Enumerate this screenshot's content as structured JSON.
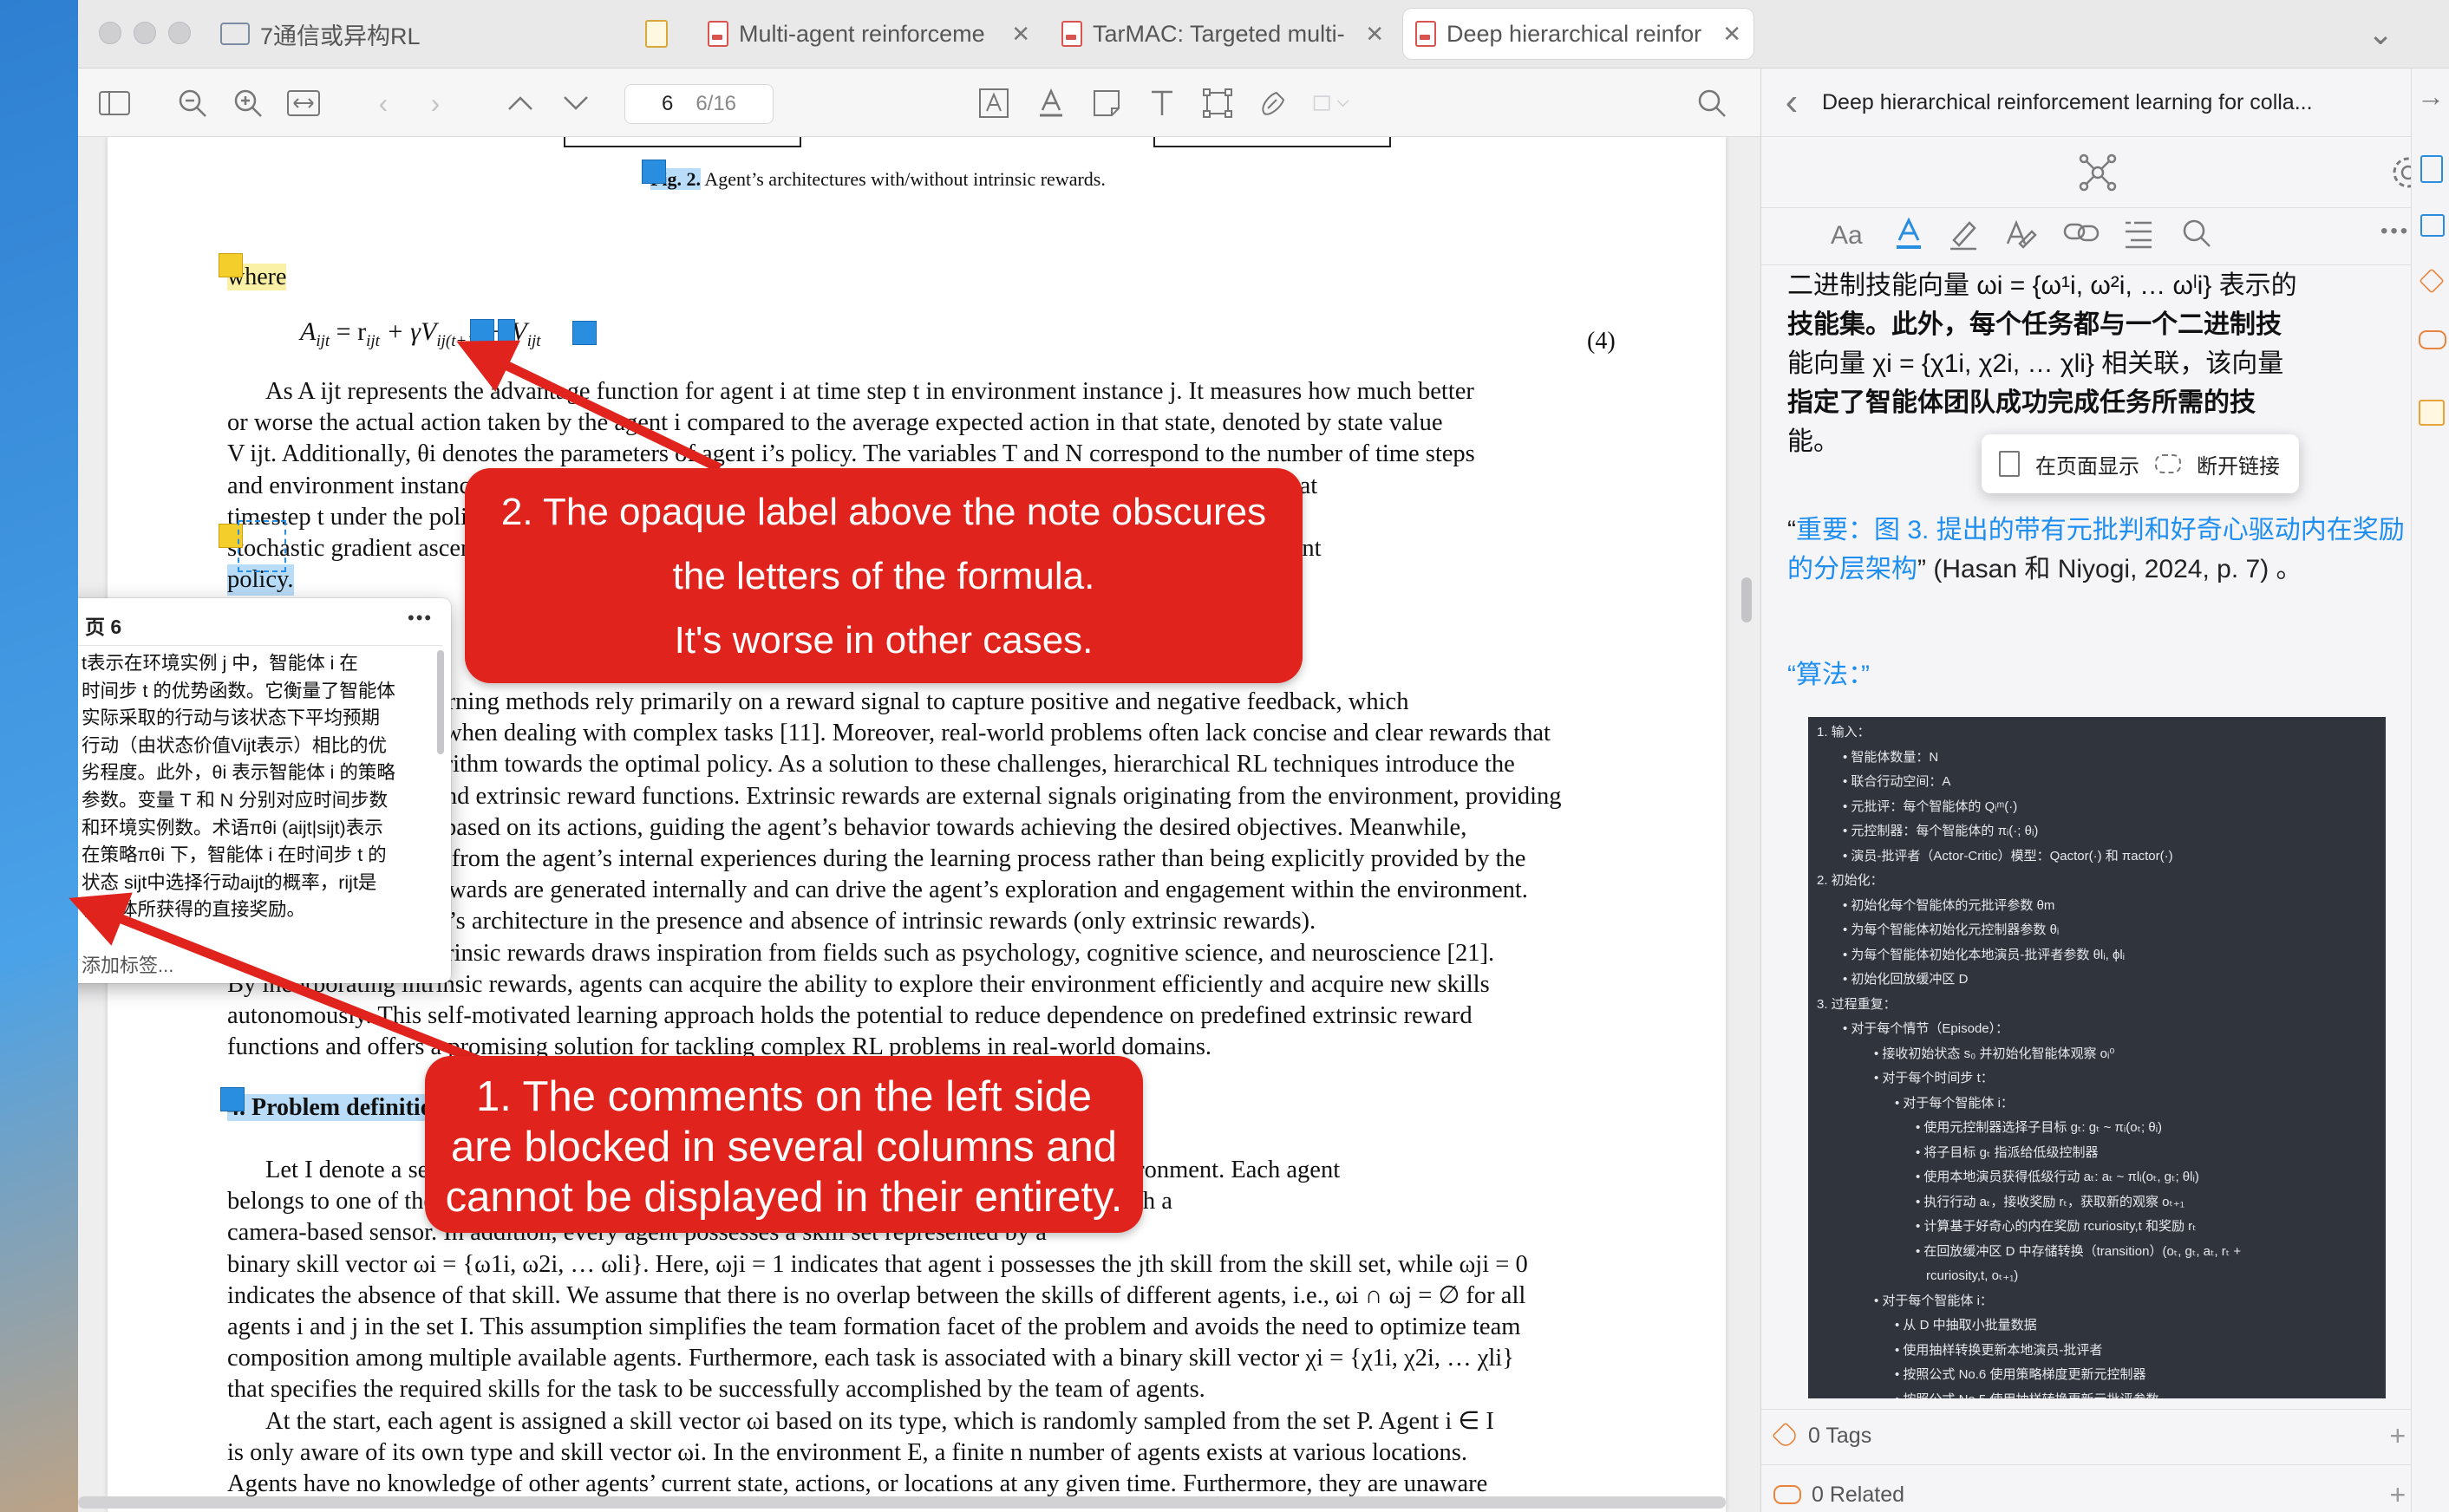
{
  "tabs": [
    {
      "label": "7通信或异构RL",
      "active": false,
      "type": "folder"
    },
    {
      "label": "",
      "active": false,
      "type": "doc"
    },
    {
      "label": "Multi-agent reinforceme",
      "active": false,
      "type": "pdf"
    },
    {
      "label": "TarMAC: Targeted multi-",
      "active": false,
      "type": "pdf"
    },
    {
      "label": "Deep hierarchical reinfor",
      "active": true,
      "type": "pdf"
    }
  ],
  "tab_close": "✕",
  "toolbar": {
    "page_current": "6",
    "page_total": "6/16"
  },
  "paper": {
    "fig_label": "Fig. 2.",
    "fig_caption": "Agent’s architectures with/without intrinsic rewards.",
    "where": "where",
    "eq_left": "A",
    "eq_sub": "ijt",
    "eq_mid": " = r",
    "eq_sub2": "ijt",
    "eq_plus": " + γV",
    "eq_sub3": "ij(t+1)",
    "eq_minus": " − V",
    "eq_sub4": "ijt",
    "eq_number": "(4)",
    "para1": [
      "As A ijt represents the advantage function for agent i at time step t in environment instance j. It measures how much better",
      "or worse the actual action taken by the agent i compared to the average expected action in that state, denoted by state value",
      "V ijt. Additionally, θi denotes the parameters of agent i’s policy. The variables T and N correspond to the number of time steps",
      "and environment instances, respectively. π(a|s) represents the probability of selecting action a ijt in state s ijt at",
      "timestep t under the policy π, and represents the direct reward obtained. The policy parameters θi via",
      "stochastic gradient ascent to maximize the expected reward, improving the policy using samples from the joint",
      "policy."
    ],
    "para2": [
      "Reinforcement learning methods rely primarily on a reward signal to capture positive and negative feedback, which",
      "becomes problematic when dealing with complex tasks [11]. Moreover, real-world problems often lack concise and clear rewards that",
      "can guide the RL algorithm towards the optimal policy. As a solution to these challenges, hierarchical RL techniques introduce the",
      "concepts of intrinsic and extrinsic reward functions. Extrinsic rewards are external signals originating from the environment, providing",
      "feedback to the agent based on its actions, guiding the agent’s behavior towards achieving the desired objectives. Meanwhile,",
      "intrinsic rewards stem from the agent’s internal experiences during the learning process rather than being explicitly provided by the",
      "environment. These rewards are generated internally and can drive the agent’s exploration and engagement within the environment.",
      "Fig. 2 shows the agent’s architecture in the presence and absence of intrinsic rewards (only extrinsic rewards).",
      "The concept of intrinsic rewards draws inspiration from fields such as psychology, cognitive science, and neuroscience [21].",
      "By incorporating intrinsic rewards, agents can acquire the ability to explore their environment efficiently and acquire new skills",
      "autonomously. This self-motivated learning approach holds the potential to reduce dependence on predefined extrinsic reward",
      "functions and offers a promising solution for tackling complex RL problems in real-world domains."
    ],
    "section": "4.  Problem definition",
    "para3": [
      "Let I denote a set of agents, where |I| = n and n is the number of agents in the given environment. Each agent",
      "belongs to one of the given set of types. For example, ρ1 corresponds to agents equipped with a",
      "camera-based sensor. In addition, every agent possesses a skill set represented by a",
      "binary skill vector ωi = {ω1i, ω2i, … ωli}. Here, ωji = 1 indicates that agent i possesses the jth skill from the skill set, while ωji = 0",
      "indicates the absence of that skill. We assume that there is no overlap between the skills of different agents, i.e., ωi ∩ ωj = ∅ for all",
      "agents i and j in the set I. This assumption simplifies the team formation facet of the problem and avoids the need to optimize team",
      "composition among multiple available agents. Furthermore, each task is associated with a binary skill vector χi = {χ1i, χ2i, … χli}",
      "that specifies the required skills for the task to be successfully accomplished by the team of agents."
    ],
    "para4": [
      "At the start, each agent is assigned a skill vector ωi based on its type, which is randomly sampled from the set P. Agent i ∈ I",
      "is only aware of its own type and skill vector ωi. In the environment E, a finite n number of agents exists at various locations.",
      "Agents have no knowledge of other agents’ current state, actions, or locations at any given time. Furthermore, they are unaware"
    ],
    "ref11": "11",
    "ref21": "21"
  },
  "note_popup": {
    "title": "页 6",
    "menu": "•••",
    "lines": [
      "t表示在环境实例 j 中，智能体 i 在",
      "时间步 t 的优势函数。它衡量了智能体",
      "实际采取的行动与该状态下平均预期",
      "行动（由状态价值Vijt表示）相比的优",
      "劣程度。此外，θi 表示智能体 i 的策略",
      "参数。变量 T 和 N 分别对应时间步数",
      "和环境实例数。术语πθi (aijt|sijt)表示",
      "在策略πθi 下，智能体 i 在时间步 t 的",
      "状态 sijt中选择行动aijt的概率，rijt是",
      "智能体所获得的直接奖励。"
    ],
    "add_tag": "添加标签..."
  },
  "callouts": {
    "c2_line1": "2. The opaque label above the note obscures",
    "c2_line2": "the letters of the formula.",
    "c2_line3": "It's worse in other cases.",
    "c1_line1": "1. The comments on the left side",
    "c1_line2": "are blocked in several columns and",
    "c1_line3": "cannot be displayed in their entirety."
  },
  "sidebar": {
    "back": "‹",
    "title": "Deep hierarchical reinforcement learning for colla...",
    "note_lines": [
      "二进制技能向量 ωi = {ω¹i, ω²i, … ωˡi} 表示的",
      "技能集。此外，每个任务都与一个二进制技",
      "能向量 χi = {χ1i, χ2i, … χli} 相关联，该向量",
      "指定了智能体团队成功完成任务所需的技",
      "能。"
    ],
    "ctx_show": "在页面显示",
    "ctx_unlink": "断开链接",
    "quote_open": "“",
    "quote_label": "重要",
    "quote_colon": "：",
    "quote_link": "图 3. 提出的带有元批判和好奇心驱动内在奖励的分层架构",
    "quote_close": "”",
    "quote_cite": " (Hasan 和 Niyogi, 2024, p. 7) 。",
    "algo_label": "“算法：”",
    "tags_label": "0 Tags",
    "related_label": "0 Related",
    "plus": "+",
    "chevron": "⌄"
  },
  "algorithm": [
    "1. 输入：",
    "• 智能体数量：N",
    "• 联合行动空间：A",
    "• 元批评：每个智能体的 Qᵢᵐ(·)",
    "• 元控制器：每个智能体的 πᵢ(·; θᵢ)",
    "• 演员-批评者（Actor-Critic）模型：Qactor(·) 和 πactor(·)",
    "2. 初始化：",
    "• 初始化每个智能体的元批评参数 θm",
    "• 为每个智能体初始化元控制器参数 θᵢ",
    "• 为每个智能体初始化本地演员-批评者参数 θlᵢ, ϕlᵢ",
    "• 初始化回放缓冲区 D",
    "3. 过程重复：",
    "• 对于每个情节（Episode）：",
    "• 接收初始状态 s₀ 并初始化智能体观察 oᵢ⁰",
    "• 对于每个时间步 t：",
    "• 对于每个智能体 i：",
    "• 使用元控制器选择子目标 gₜ: gₜ ~ πᵢ(oₜ; θᵢ)",
    "• 将子目标 gₜ 指派给低级控制器",
    "• 使用本地演员获得低级行动 aₜ: aₜ ~ πlᵢ(oₜ, gₜ; θlᵢ)",
    "• 执行行动 aₜ，接收奖励 rₜ，获取新的观察 oₜ₊₁",
    "• 计算基于好奇心的内在奖励 rcuriosity,t 和奖励 rₜ",
    "• 在回放缓冲区 D 中存储转换（transition）(oₜ, gₜ, aₜ, rₜ +",
    "rcuriosity,t, oₜ₊₁)",
    "• 对于每个智能体 i：",
    "• 从 D 中抽取小批量数据",
    "• 使用抽样转换更新本地演员-批评者",
    "• 按照公式 No.6 使用策略梯度更新元控制器",
    "• 按照公式 No.5 使用抽样转换更新元批评参数"
  ],
  "colors": {
    "callout": "#e0231c",
    "highlight_blue": "#b9dcf8",
    "highlight_yellow": "#fbf1a6",
    "link_blue": "#1f8ef1",
    "algo_bg": "#2f343d"
  }
}
